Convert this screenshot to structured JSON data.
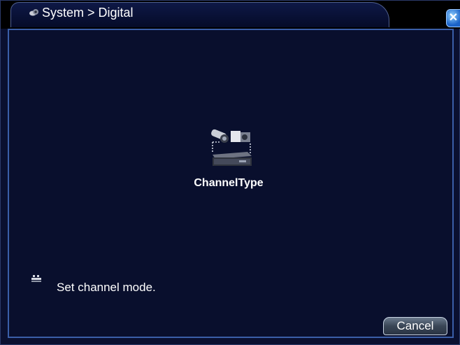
{
  "window": {
    "title": "System > Digital",
    "close_label": "✕"
  },
  "main": {
    "items": [
      {
        "label": "ChannelType",
        "icon": "channel-type-icon"
      }
    ]
  },
  "hint": {
    "text": "Set channel mode.",
    "icon": "hint-icon"
  },
  "footer": {
    "cancel_label": "Cancel"
  },
  "colors": {
    "background": "#090f2d",
    "border": "#3a5ea8",
    "text": "#ffffff"
  }
}
